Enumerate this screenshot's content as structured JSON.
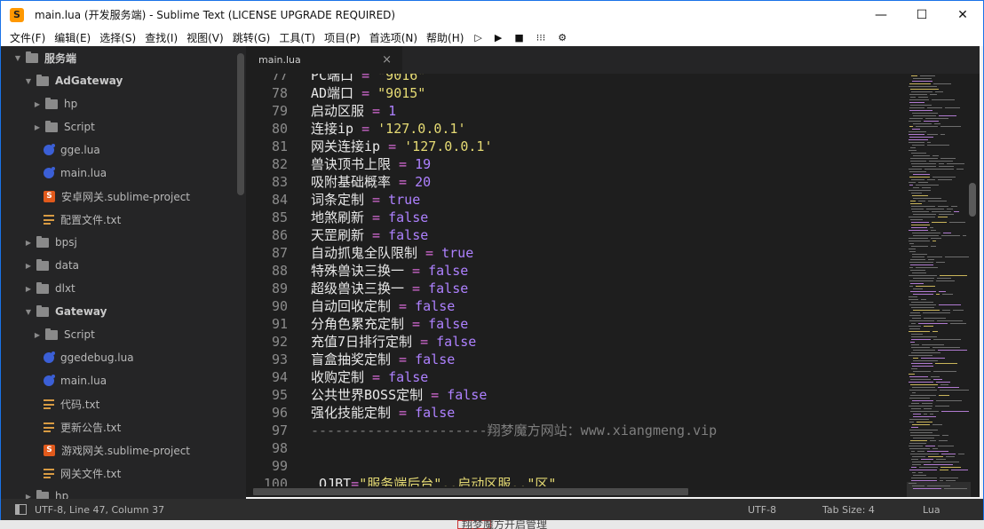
{
  "window": {
    "title": "main.lua (开发服务端) - Sublime Text (LICENSE UPGRADE REQUIRED)",
    "icon_letter": "S",
    "controls": {
      "minimize": "—",
      "maximize": "☐",
      "close": "✕"
    }
  },
  "menu": {
    "items": [
      "文件(F)",
      "编辑(E)",
      "选择(S)",
      "查找(I)",
      "视图(V)",
      "跳转(G)",
      "工具(T)",
      "项目(P)",
      "首选项(N)",
      "帮助(H)"
    ],
    "tools": [
      "▷",
      "▶",
      "■",
      "⁝⁝⁝",
      "⚙"
    ]
  },
  "sidebar": {
    "items": [
      {
        "label": "服务端",
        "type": "root"
      },
      {
        "label": "AdGateway",
        "type": "folder-open"
      },
      {
        "label": "hp",
        "type": "folder"
      },
      {
        "label": "Script",
        "type": "folder"
      },
      {
        "label": "gge.lua",
        "type": "lua"
      },
      {
        "label": "main.lua",
        "type": "lua"
      },
      {
        "label": "安卓网关.sublime-project",
        "type": "proj"
      },
      {
        "label": "配置文件.txt",
        "type": "txt"
      },
      {
        "label": "bpsj",
        "type": "folder"
      },
      {
        "label": "data",
        "type": "folder"
      },
      {
        "label": "dlxt",
        "type": "folder"
      },
      {
        "label": "Gateway",
        "type": "folder-open"
      },
      {
        "label": "Script",
        "type": "folder"
      },
      {
        "label": "ggedebug.lua",
        "type": "lua"
      },
      {
        "label": "main.lua",
        "type": "lua"
      },
      {
        "label": "代码.txt",
        "type": "txt"
      },
      {
        "label": "更新公告.txt",
        "type": "txt"
      },
      {
        "label": "游戏网关.sublime-project",
        "type": "proj"
      },
      {
        "label": "网关文件.txt",
        "type": "txt"
      },
      {
        "label": "hp",
        "type": "folder"
      }
    ]
  },
  "tab": {
    "label": "main.lua",
    "close": "×"
  },
  "editor": {
    "lines": [
      {
        "n": "77",
        "key": "PC端口",
        "op": " = ",
        "val": "\"9016\"",
        "cls": "str"
      },
      {
        "n": "78",
        "key": "AD端口",
        "op": " = ",
        "val": "\"9015\"",
        "cls": "str"
      },
      {
        "n": "79",
        "key": "启动区服",
        "op": " = ",
        "val": "1",
        "cls": "num"
      },
      {
        "n": "80",
        "key": "连接ip",
        "op": " = ",
        "val": "'127.0.0.1'",
        "cls": "str"
      },
      {
        "n": "81",
        "key": "网关连接ip",
        "op": " = ",
        "val": "'127.0.0.1'",
        "cls": "str"
      },
      {
        "n": "82",
        "key": "兽诀顶书上限",
        "op": " = ",
        "val": "19",
        "cls": "num"
      },
      {
        "n": "83",
        "key": "吸附基础概率",
        "op": " = ",
        "val": "20",
        "cls": "num"
      },
      {
        "n": "84",
        "key": "词条定制",
        "op": " = ",
        "val": "true",
        "cls": "kw"
      },
      {
        "n": "85",
        "key": "地煞刷新",
        "op": " = ",
        "val": "false",
        "cls": "kw"
      },
      {
        "n": "86",
        "key": "天罡刷新",
        "op": " = ",
        "val": "false",
        "cls": "kw"
      },
      {
        "n": "87",
        "key": "自动抓鬼全队限制",
        "op": " = ",
        "val": "true",
        "cls": "kw"
      },
      {
        "n": "88",
        "key": "特殊兽诀三换一",
        "op": " = ",
        "val": "false",
        "cls": "kw"
      },
      {
        "n": "89",
        "key": "超级兽诀三换一",
        "op": " = ",
        "val": "false",
        "cls": "kw"
      },
      {
        "n": "90",
        "key": "自动回收定制",
        "op": " = ",
        "val": "false",
        "cls": "kw"
      },
      {
        "n": "91",
        "key": "分角色累充定制",
        "op": " = ",
        "val": "false",
        "cls": "kw"
      },
      {
        "n": "92",
        "key": "充值7日排行定制",
        "op": " = ",
        "val": "false",
        "cls": "kw"
      },
      {
        "n": "93",
        "key": "盲盒抽奖定制",
        "op": " = ",
        "val": "false",
        "cls": "kw"
      },
      {
        "n": "94",
        "key": "收购定制",
        "op": " = ",
        "val": "false",
        "cls": "kw"
      },
      {
        "n": "95",
        "key": "公共世界BOSS定制",
        "op": " = ",
        "val": "false",
        "cls": "kw"
      },
      {
        "n": "96",
        "key": "强化技能定制",
        "op": " = ",
        "val": "false",
        "cls": "kw"
      },
      {
        "n": "97",
        "key": "",
        "op": "",
        "val": "----------------------翔梦魔方网站：www.xiangmeng.vip",
        "cls": "cmt"
      },
      {
        "n": "98",
        "key": "",
        "op": "",
        "val": "",
        "cls": "cmt"
      },
      {
        "n": "99",
        "key": "",
        "op": "",
        "val": "",
        "cls": "cmt"
      },
      {
        "n": "100",
        "key": " QJBT",
        "op": "=",
        "val": "\"服务端后台\"..启动区服..\"区\"",
        "cls": "str"
      }
    ]
  },
  "status": {
    "position": "UTF-8, Line 47, Column 37",
    "encoding": "UTF-8",
    "tab_size": "Tab Size: 4",
    "syntax": "Lua"
  },
  "background_text": "翔梦魔方开启管理"
}
